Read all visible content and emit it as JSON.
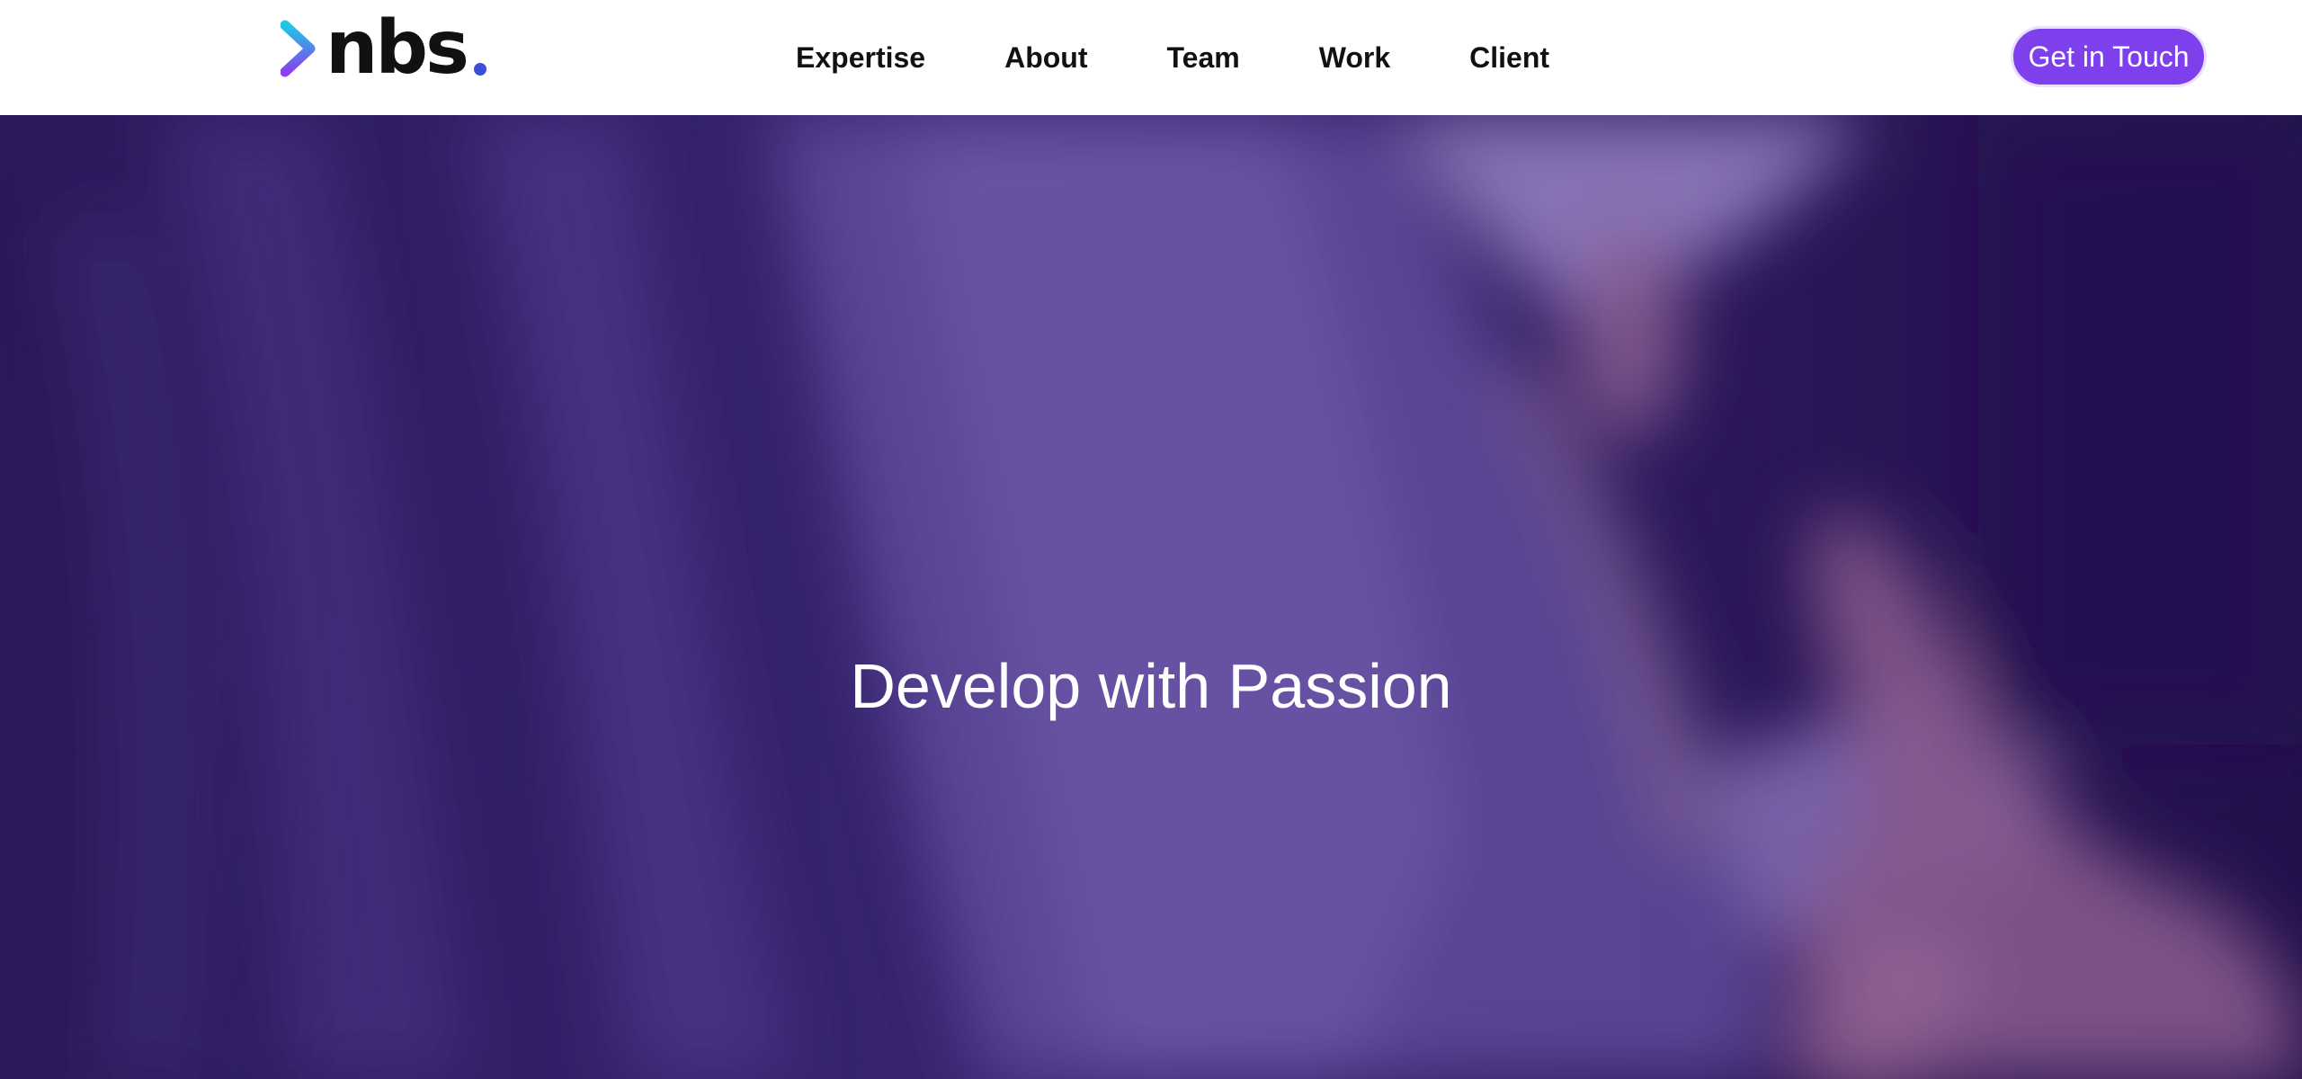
{
  "brand": {
    "name": "nbs",
    "accent_color": "#7e3fec",
    "logo_mark_gradient": [
      "#1ec8e6",
      "#8a3ff0"
    ],
    "dot_color": "#3b4fd8"
  },
  "nav": {
    "items": [
      {
        "label": "Expertise"
      },
      {
        "label": "About"
      },
      {
        "label": "Team"
      },
      {
        "label": "Work"
      },
      {
        "label": "Client"
      }
    ]
  },
  "cta": {
    "label": "Get in Touch"
  },
  "hero": {
    "title": "Develop with Passion",
    "overlay_color": "#3a2270"
  }
}
